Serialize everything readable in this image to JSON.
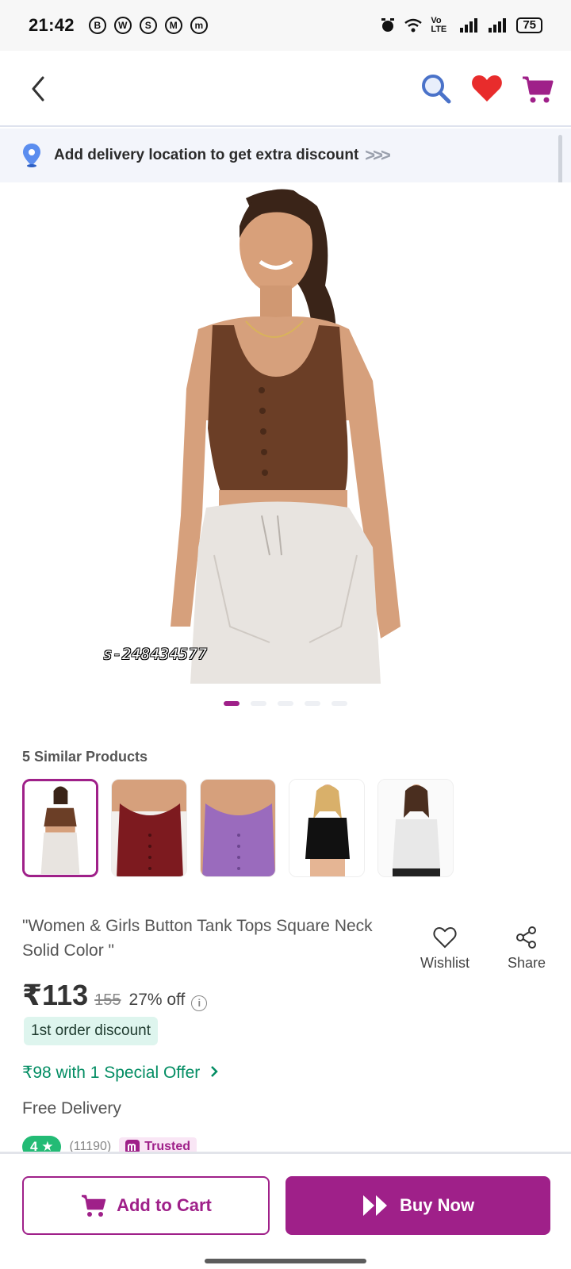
{
  "status_bar": {
    "time": "21:42",
    "left_icons": [
      "B",
      "W",
      "S",
      "M",
      "m"
    ],
    "network": "Vo LTE",
    "battery": "75"
  },
  "header": {
    "icons": [
      "back-icon",
      "search-icon",
      "heart-icon",
      "cart-icon"
    ]
  },
  "delivery_banner": {
    "text": "Add delivery location to get extra discount",
    "arrows": ">>>"
  },
  "product_image": {
    "code": "s-248434577",
    "total_images": 5,
    "active_index": 0
  },
  "similar": {
    "title": "5 Similar Products",
    "thumbs": [
      {
        "color": "#6b3e26",
        "label": "brown"
      },
      {
        "color": "#7d1a1f",
        "label": "maroon"
      },
      {
        "color": "#9a6bbd",
        "label": "lavender"
      },
      {
        "color": "#111111",
        "label": "black"
      },
      {
        "color": "#e8e8e8",
        "label": "white"
      }
    ]
  },
  "product": {
    "title": "\"Women & Girls Button Tank Tops Square Neck Solid Color \"",
    "price": "₹113",
    "mrp": "155",
    "discount": "27% off",
    "first_order_badge": "1st order discount",
    "special_offer": "₹98 with 1 Special Offer",
    "delivery": "Free Delivery",
    "rating": "4",
    "rating_count": "(11190)",
    "trusted_label": "Trusted"
  },
  "actions": {
    "wishlist_label": "Wishlist",
    "share_label": "Share"
  },
  "bottom_bar": {
    "add_to_cart": "Add to Cart",
    "buy_now": "Buy Now"
  },
  "colors": {
    "brand": "#9f2089",
    "offer_green": "#038d63",
    "rating_green": "#23bb75",
    "search_blue": "#4a72c9",
    "heart_red": "#e82c2c"
  }
}
